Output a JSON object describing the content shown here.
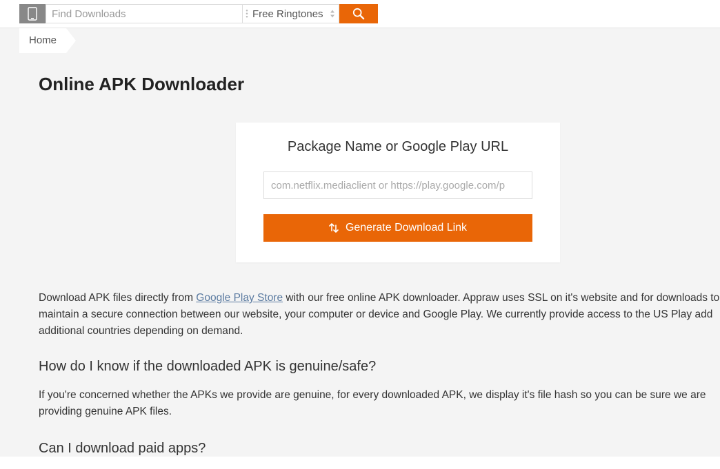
{
  "topbar": {
    "search_placeholder": "Find Downloads",
    "category": "Free Ringtones"
  },
  "breadcrumb": {
    "home": "Home"
  },
  "page": {
    "title": "Online APK Downloader",
    "card_title": "Package Name or Google Play URL",
    "url_placeholder": "com.netflix.mediaclient or https://play.google.com/p",
    "generate_label": "Generate Download Link",
    "desc_before": "Download APK files directly from ",
    "desc_link": "Google Play Store",
    "desc_after": " with our free online APK downloader. Appraw uses SSL on it's website and for downloads to maintain a secure connection between our website, your computer or device and Google Play. We currently provide access to the US Play add additional countries depending on demand.",
    "h2a": "How do I know if the downloaded APK is genuine/safe?",
    "p2": "If you're concerned whether the APKs we provide are genuine, for every downloaded APK, we display it's file hash so you can be sure we are providing genuine APK files.",
    "h2b": "Can I download paid apps?"
  }
}
